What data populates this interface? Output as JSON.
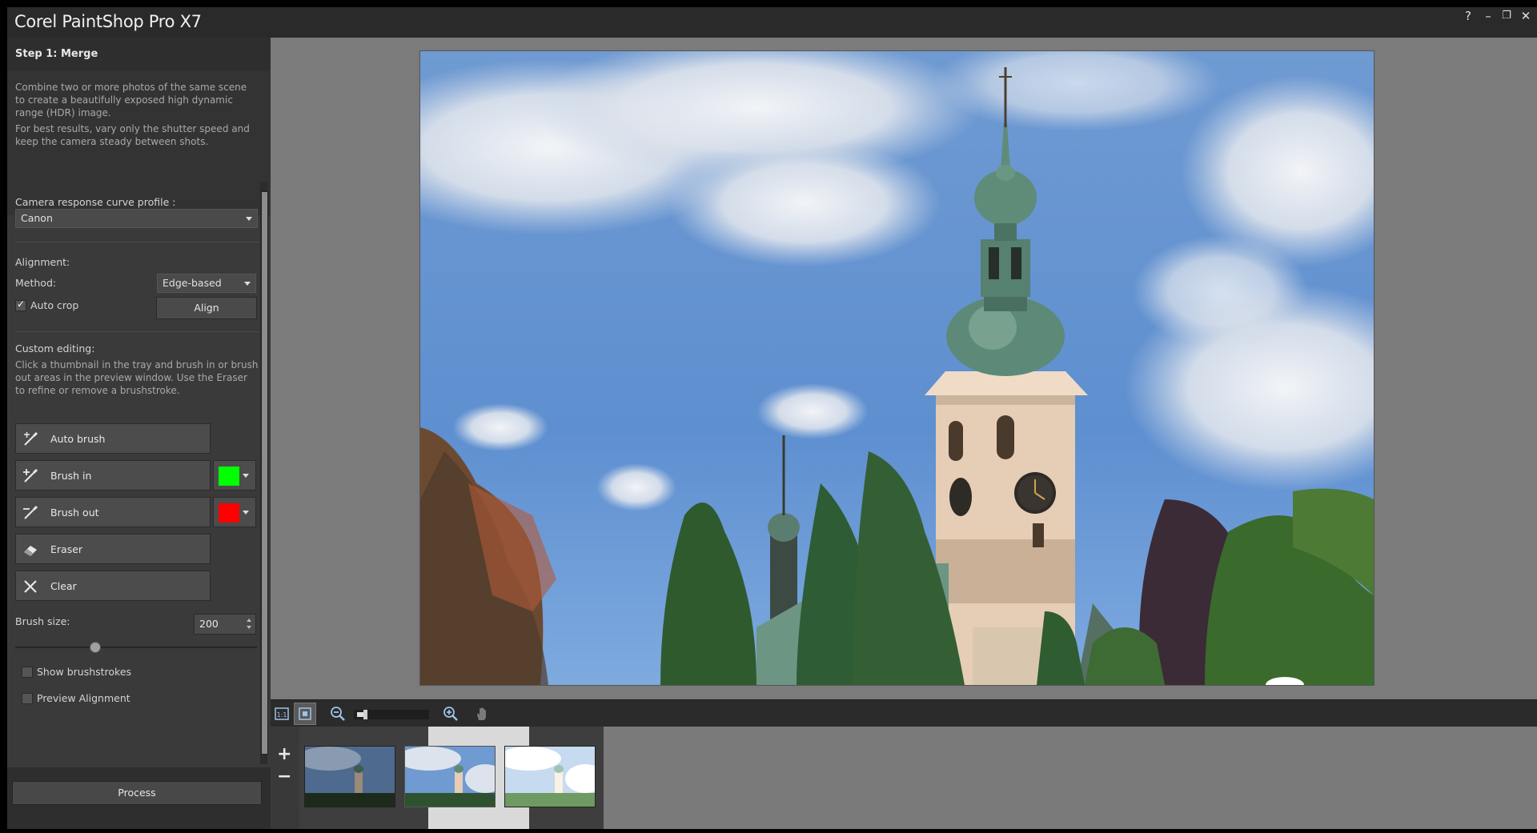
{
  "window": {
    "title": "Corel PaintShop Pro X7",
    "help_label": "?",
    "minimize_label": "–",
    "restore_label": "❐",
    "close_label": "✕"
  },
  "panel": {
    "step_title": "Step 1: Merge",
    "intro_1": "Combine two or more photos of the same scene to create a beautifully exposed high dynamic range (HDR) image.",
    "intro_2": "For best results, vary only the shutter speed and keep the camera steady between shots.",
    "camera_label": "Camera response curve profile :",
    "camera_value": "Canon",
    "alignment_label": "Alignment:",
    "method_label": "Method:",
    "method_value": "Edge-based",
    "auto_crop_label": "Auto crop",
    "auto_crop_checked": true,
    "align_button": "Align",
    "custom_label": "Custom editing:",
    "custom_desc": "Click a thumbnail in the tray and brush in or brush out areas in the preview window. Use the Eraser to refine or remove a brushstroke.",
    "tools": [
      {
        "label": "Auto brush",
        "icon": "auto-brush-icon"
      },
      {
        "label": "Brush in",
        "icon": "brush-in-icon",
        "color": "#00ff00"
      },
      {
        "label": "Brush out",
        "icon": "brush-out-icon",
        "color": "#ff0000"
      },
      {
        "label": "Eraser",
        "icon": "eraser-icon"
      },
      {
        "label": "Clear",
        "icon": "clear-icon"
      }
    ],
    "brush_size_label": "Brush size:",
    "brush_size_value": "200",
    "show_brushstrokes_label": "Show brushstrokes",
    "preview_alignment_label": "Preview Alignment",
    "process_button": "Process"
  },
  "tray": {
    "add_label": "+",
    "remove_label": "−",
    "selected_index": 1
  }
}
